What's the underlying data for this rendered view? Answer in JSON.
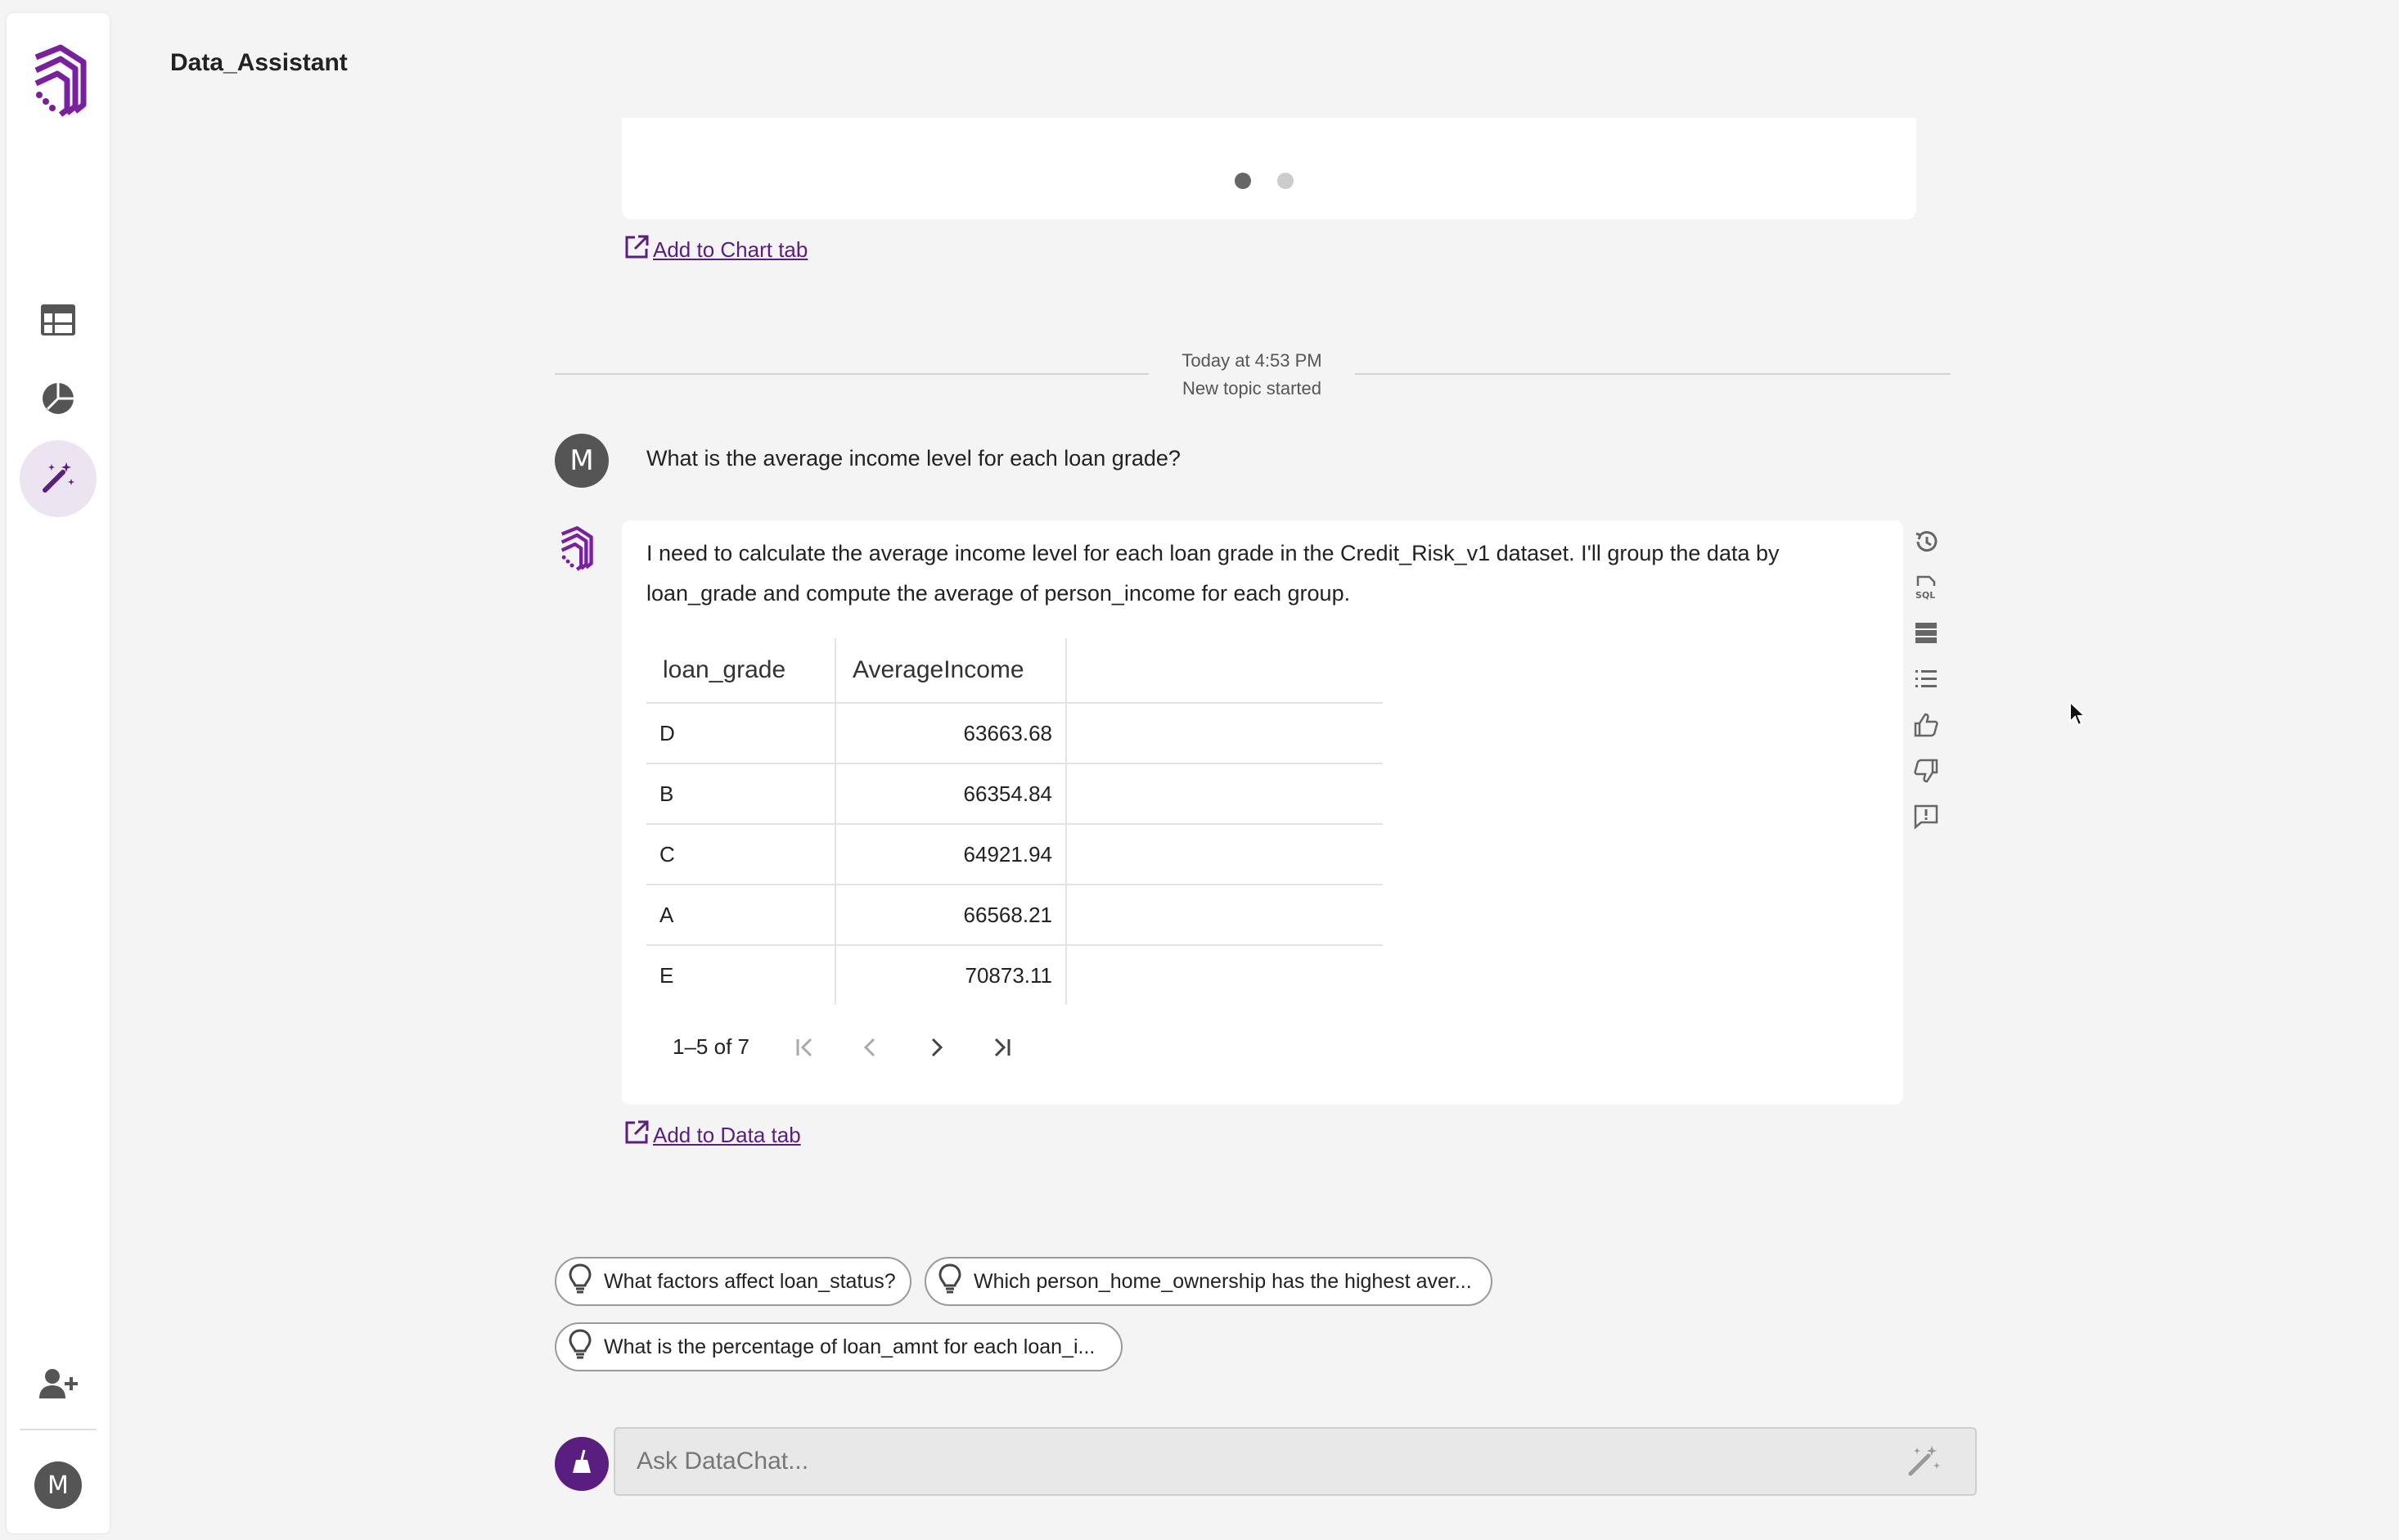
{
  "app": {
    "title": "Data_Assistant"
  },
  "sidebar": {
    "items": [
      {
        "icon": "table-icon",
        "active": false
      },
      {
        "icon": "pie-chart-icon",
        "active": false
      },
      {
        "icon": "magic-wand-icon",
        "active": true
      }
    ],
    "add_user_icon": "add-user-icon",
    "user_avatar": "M"
  },
  "chart_card": {
    "carousel_pages": 2,
    "current_page": 1,
    "link_label": "Add to Chart tab"
  },
  "divider": {
    "time": "Today at 4:53 PM",
    "label": "New topic started"
  },
  "user_message": {
    "avatar": "M",
    "text": "What is the average income level for each loan grade?"
  },
  "assistant_message": {
    "text": "I need to calculate the average income level for each loan grade in the Credit_Risk_v1 dataset. I'll group the data by loan_grade and compute the average of person_income for each group.",
    "table": {
      "columns": [
        "loan_grade",
        "AverageIncome"
      ],
      "rows": [
        [
          "D",
          "63663.68"
        ],
        [
          "B",
          "66354.84"
        ],
        [
          "C",
          "64921.94"
        ],
        [
          "A",
          "66568.21"
        ],
        [
          "E",
          "70873.11"
        ]
      ],
      "pagination": "1–5 of 7"
    },
    "link_label": "Add to Data tab",
    "actions": [
      "history-icon",
      "sql-icon",
      "data-icon",
      "steps-list-icon",
      "thumbs-up-icon",
      "thumbs-down-icon",
      "feedback-icon"
    ]
  },
  "suggestions": [
    "What factors affect loan_status?",
    "Which person_home_ownership has the highest aver...",
    "What is the percentage of loan_amnt for each loan_i..."
  ],
  "input": {
    "placeholder": "Ask DataChat..."
  },
  "colors": {
    "brand": "#5a1d80",
    "background": "#f4f4f5"
  }
}
